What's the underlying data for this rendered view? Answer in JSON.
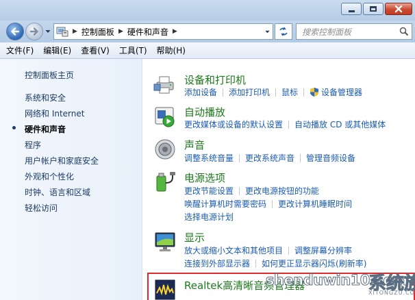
{
  "address": {
    "crumbs": [
      "控制面板",
      "硬件和声音"
    ]
  },
  "search": {
    "placeholder": "搜索控制面板"
  },
  "menu": [
    "文件(F)",
    "编辑(E)",
    "查看(V)",
    "工具(T)",
    "帮助(H)"
  ],
  "sidebar": {
    "items": [
      {
        "label": "控制面板主页"
      },
      {
        "label": "系统和安全"
      },
      {
        "label": "网络和 Internet"
      },
      {
        "label": "硬件和声音",
        "current": true
      },
      {
        "label": "程序"
      },
      {
        "label": "用户帐户和家庭安全"
      },
      {
        "label": "外观和个性化"
      },
      {
        "label": "时钟、语言和区域"
      },
      {
        "label": "轻松访问"
      }
    ]
  },
  "categories": [
    {
      "title": "设备和打印机",
      "icon": "printer-icon",
      "rows": [
        [
          "添加设备",
          "添加打印机",
          "鼠标",
          "设备管理器"
        ]
      ]
    },
    {
      "title": "自动播放",
      "icon": "autoplay-icon",
      "rows": [
        [
          "更改媒体或设备的默认设置",
          "自动播放 CD 或其他媒体"
        ]
      ]
    },
    {
      "title": "声音",
      "icon": "speaker-icon",
      "rows": [
        [
          "调整系统音量",
          "更改系统声音",
          "管理音频设备"
        ]
      ]
    },
    {
      "title": "电源选项",
      "icon": "power-icon",
      "rows": [
        [
          "更改节能设置",
          "更改电源按钮的功能"
        ],
        [
          "唤醒计算机时需要密码",
          "更改计算机睡眠时间"
        ],
        [
          "选择电源计划"
        ]
      ]
    },
    {
      "title": "显示",
      "icon": "display-icon",
      "rows": [
        [
          "放大或缩小文本和其他项目",
          "调整屏幕分辨率"
        ],
        [
          "连接到外部显示器",
          "如何更正显示器闪烁(刷新率)"
        ]
      ]
    },
    {
      "title": "Realtek高清晰音频管理器",
      "icon": "realtek-icon",
      "rows": []
    }
  ],
  "watermark": {
    "text": "shenduwin10.com",
    "cn": "系统族",
    "sub": "XITONGZU.COM"
  },
  "colors": {
    "link": "#1a5bb3",
    "category_title": "#1b7a1b",
    "highlight": "#e02a2a"
  }
}
